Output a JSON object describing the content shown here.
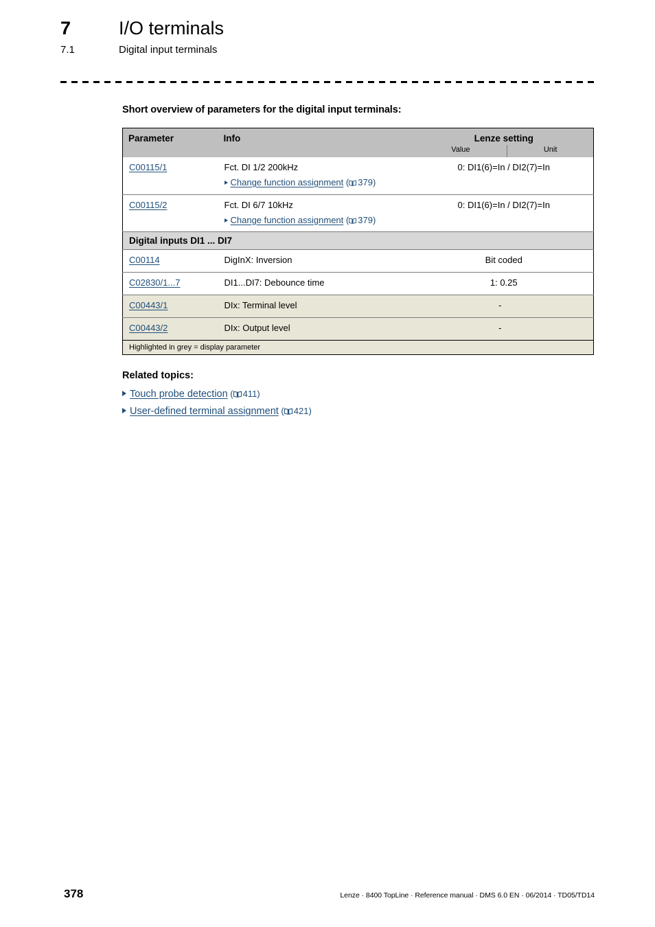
{
  "header": {
    "chapter_number": "7",
    "chapter_title": "I/O terminals",
    "section_number": "7.1",
    "section_title": "Digital input terminals"
  },
  "main": {
    "overview_title": "Short overview of parameters for the digital input terminals:"
  },
  "table": {
    "headers": {
      "parameter": "Parameter",
      "info": "Info",
      "lenze_setting": "Lenze setting",
      "value": "Value",
      "unit": "Unit"
    },
    "rows": [
      {
        "parameter": "C00115/1",
        "info": "Fct. DI 1/2 200kHz",
        "sublink": "Change function assignment",
        "subpage": "379",
        "value": "0: DI1(6)=In / DI2(7)=In",
        "unit": ""
      },
      {
        "parameter": "C00115/2",
        "info": "Fct. DI 6/7 10kHz",
        "sublink": "Change function assignment",
        "subpage": "379",
        "value": "0: DI1(6)=In / DI2(7)=In",
        "unit": ""
      }
    ],
    "section_label": "Digital inputs DI1 ... DI7",
    "rows2": [
      {
        "parameter": "C00114",
        "info": "DigInX: Inversion",
        "value": "Bit coded",
        "unit": "",
        "highlighted": false
      },
      {
        "parameter": "C02830/1...7",
        "info": "DI1...DI7: Debounce time",
        "value": "1: 0.25",
        "unit": "",
        "highlighted": false
      },
      {
        "parameter": "C00443/1",
        "info": "DIx: Terminal level",
        "value": "-",
        "unit": "",
        "highlighted": true
      },
      {
        "parameter": "C00443/2",
        "info": "DIx: Output level",
        "value": "-",
        "unit": "",
        "highlighted": true
      }
    ],
    "footnote": "Highlighted in grey = display parameter"
  },
  "related": {
    "title": "Related topics:",
    "items": [
      {
        "label": "Touch probe detection",
        "page": "411"
      },
      {
        "label": "User-defined terminal assignment",
        "page": "421"
      }
    ]
  },
  "footer": {
    "page_number": "378",
    "text": "Lenze · 8400 TopLine · Reference manual · DMS 6.0 EN · 06/2014 · TD05/TD14"
  },
  "colors": {
    "link": "#1f4e79",
    "table_header_bg": "#bfbfbf",
    "section_bg": "#d7d7d7",
    "highlight_bg": "#e8e6d7"
  }
}
